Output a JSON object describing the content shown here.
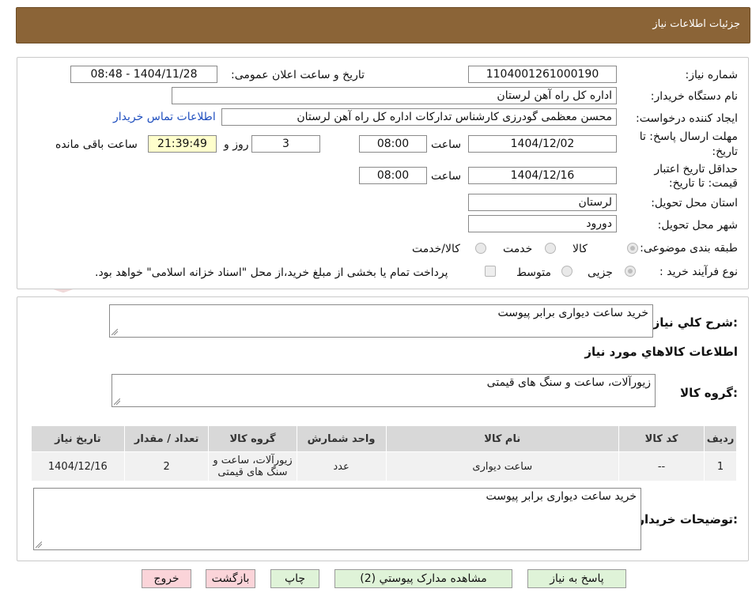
{
  "header": {
    "title": "جزئیات اطلاعات نیاز"
  },
  "form": {
    "need_number_label": "شماره نیاز:",
    "need_number": "1104001261000190",
    "announce_label": "تاریخ و ساعت اعلان عمومی:",
    "announce_value": "1404/11/28 - 08:48",
    "buyer_org_label": "نام دستگاه خریدار:",
    "buyer_org": "اداره کل راه آهن لرستان",
    "requester_label": "ایجاد کننده درخواست:",
    "requester": "محسن معظمی گودرزی کارشناس تدارکات اداره کل راه آهن لرستان",
    "contact_link": "اطلاعات تماس خریدار",
    "deadline_label_1": "مهلت ارسال پاسخ: تا",
    "deadline_label_2": "تاریخ:",
    "deadline_date": "1404/12/02",
    "time_label": "ساعت",
    "deadline_time": "08:00",
    "days_value": "3",
    "days_label": "روز و",
    "remaining_time": "21:39:49",
    "remaining_label": "ساعت باقی مانده",
    "validity_label_1": "حداقل تاریخ اعتبار",
    "validity_label_2": "قیمت: تا تاریخ:",
    "validity_date": "1404/12/16",
    "validity_time": "08:00",
    "province_label": "استان محل تحویل:",
    "province": "لرستان",
    "city_label": "شهر محل تحویل:",
    "city": "دورود",
    "category_label": "طبقه بندی موضوعی:",
    "category_options": [
      "کالا",
      "خدمت",
      "کالا/خدمت"
    ],
    "purchase_label": "نوع فرآیند خرید :",
    "purchase_options": [
      "جزیی",
      "متوسط"
    ],
    "payment_note": "پرداخت تمام یا بخشی از مبلغ خرید،از محل \"اسناد خزانه اسلامی\" خواهد بود."
  },
  "summary": {
    "label": "شرح کلي نياز:",
    "text": "خرید ساعت دیواری برابر پیوست",
    "goods_info_title": "اطلاعات کالاهاي مورد نياز",
    "group_label": "گروه کالا:",
    "group_text": "زیورآلات، ساعت و سنگ های قیمتی"
  },
  "table": {
    "headers": [
      "رديف",
      "کد کالا",
      "نام کالا",
      "واحد شمارش",
      "گروه کالا",
      "تعداد / مقدار",
      "تاریخ نیاز"
    ],
    "rows": [
      [
        "1",
        "--",
        "ساعت دیواری",
        "عدد",
        "زیورآلات، ساعت و سنگ های قیمتی",
        "2",
        "1404/12/16"
      ]
    ]
  },
  "buyer_notes": {
    "label": "توضیحات خریدار:",
    "text": "خرید ساعت دیواری برابر پیوست"
  },
  "buttons": {
    "reply": "پاسخ به نیاز",
    "attachments": "مشاهده مدارک پیوستي (2)",
    "print": "چاپ",
    "back": "بازگشت",
    "exit": "خروج"
  },
  "colors": {
    "header_bg": "#8b6437",
    "link": "#1f4fbf",
    "highlight": "#ffffcc"
  }
}
